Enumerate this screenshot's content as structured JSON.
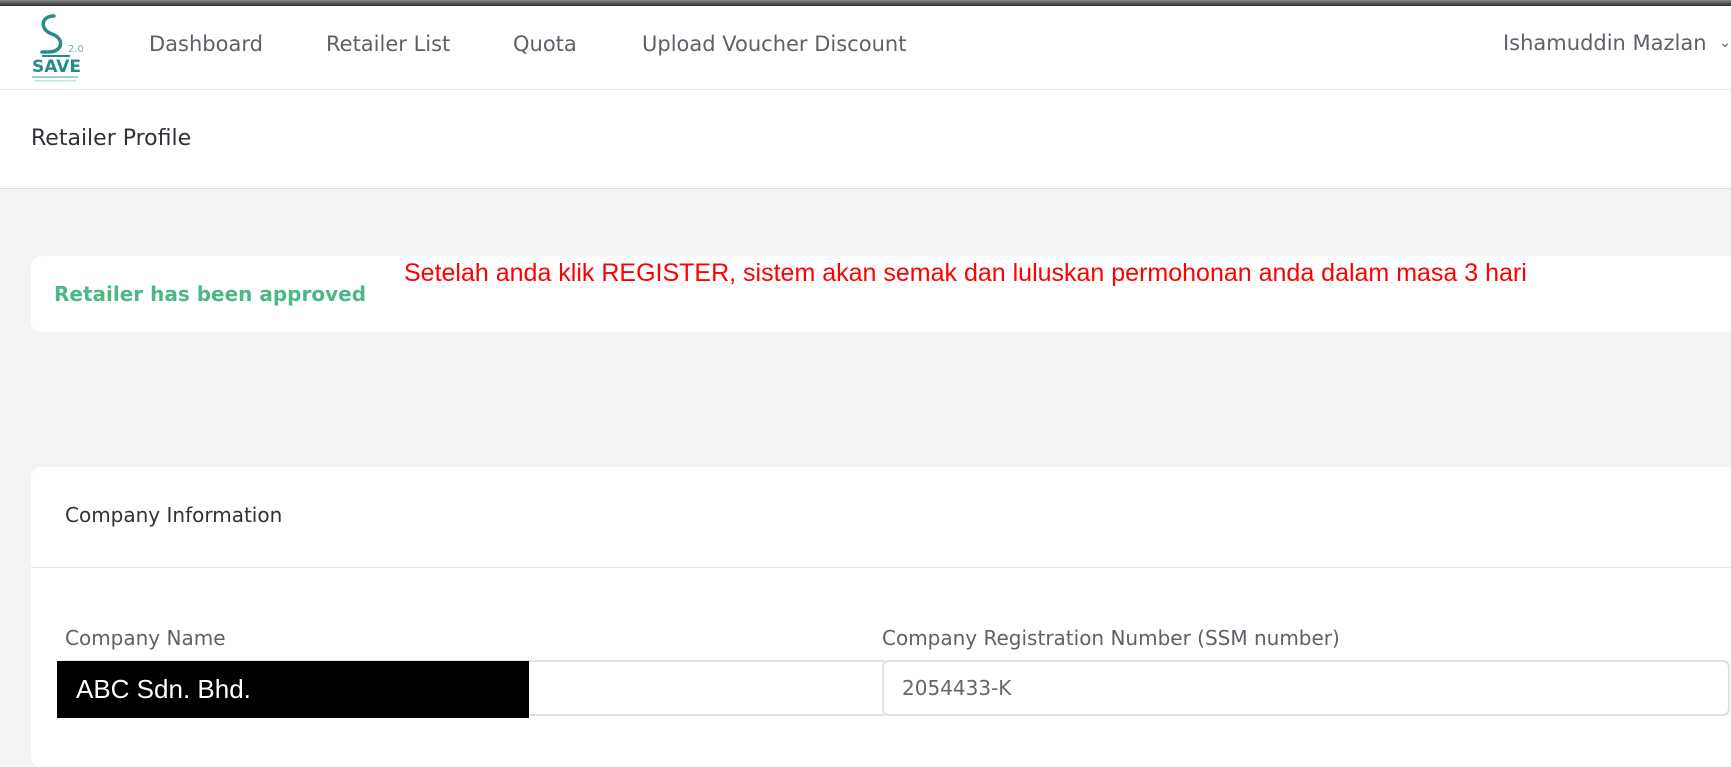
{
  "nav": {
    "logo_text": "SAVE",
    "logo_version": "2.0",
    "items": [
      "Dashboard",
      "Retailer List",
      "Quota",
      "Upload Voucher Discount"
    ],
    "user_name": "Ishamuddin Mazlan"
  },
  "page": {
    "title": "Retailer Profile"
  },
  "alert": {
    "status": "Retailer has been approved",
    "annotation": "Setelah anda klik REGISTER, sistem akan semak dan luluskan permohonan anda dalam masa 3 hari"
  },
  "company": {
    "section_title": "Company Information",
    "name_label": "Company Name",
    "name_value": "ABC Sdn. Bhd.",
    "reg_label": "Company Registration Number (SSM number)",
    "reg_value": "2054433-K"
  },
  "colors": {
    "approved": "#4cb883",
    "annotation": "#ff0000",
    "logo": "#2a8b8b"
  },
  "icons": [
    "save-logo-icon",
    "chevron-down-icon"
  ]
}
